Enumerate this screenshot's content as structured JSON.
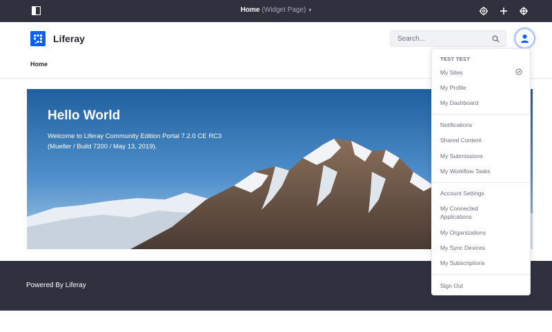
{
  "control_bar": {
    "page_title": "Home",
    "page_subtitle": "(Widget Page)",
    "icons": [
      "product-menu-icon",
      "gear-icon",
      "plus-icon",
      "simulation-icon"
    ],
    "caret": "▾"
  },
  "header": {
    "site_name": "Liferay",
    "search_placeholder": "Search...",
    "nav_home": "Home"
  },
  "banner": {
    "title": "Hello World",
    "text": "Welcome to Liferay Community Edition Portal 7.2.0 CE RC3 (Mueller / Build 7200 / May 13, 2019)."
  },
  "footer": {
    "text": "Powered By Liferay"
  },
  "user_menu": {
    "header": "TEST TEST",
    "group1": [
      "My Sites",
      "My Profile",
      "My Dashboard"
    ],
    "group2": [
      "Notifications",
      "Shared Content",
      "My Submissions",
      "My Workflow Tasks"
    ],
    "group3": [
      "Account Settings",
      "My Connected Applications",
      "My Organizations",
      "My Sync Devices",
      "My Subscriptions"
    ],
    "group4": [
      "Sign Out"
    ]
  },
  "colors": {
    "control_bar": "#30313f",
    "accent": "#0b5fff",
    "footer": "#30313f"
  }
}
